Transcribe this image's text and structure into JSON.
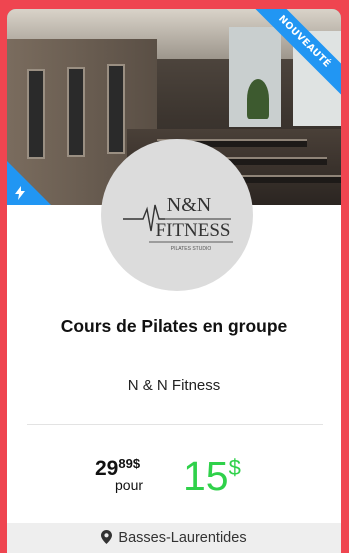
{
  "deal": {
    "badge": "NOUVEAUTÉ",
    "logo": {
      "brand_line1": "N&N",
      "brand_line2": "FITNESS",
      "tagline": "PILATES STUDIO"
    },
    "title": "Cours de Pilates en groupe",
    "merchant": "N & N Fitness",
    "old_price_int": "29",
    "old_price_dec": "89$",
    "per_label": "pour",
    "new_price": "15",
    "new_price_currency": "$",
    "location": "Basses-Laurentides"
  },
  "colors": {
    "background": "#ef4550",
    "accent_blue": "#2196f3",
    "price_green": "#2fd14a"
  },
  "icons": {
    "badge_corner": "lightning-icon",
    "location": "map-pin-icon"
  }
}
